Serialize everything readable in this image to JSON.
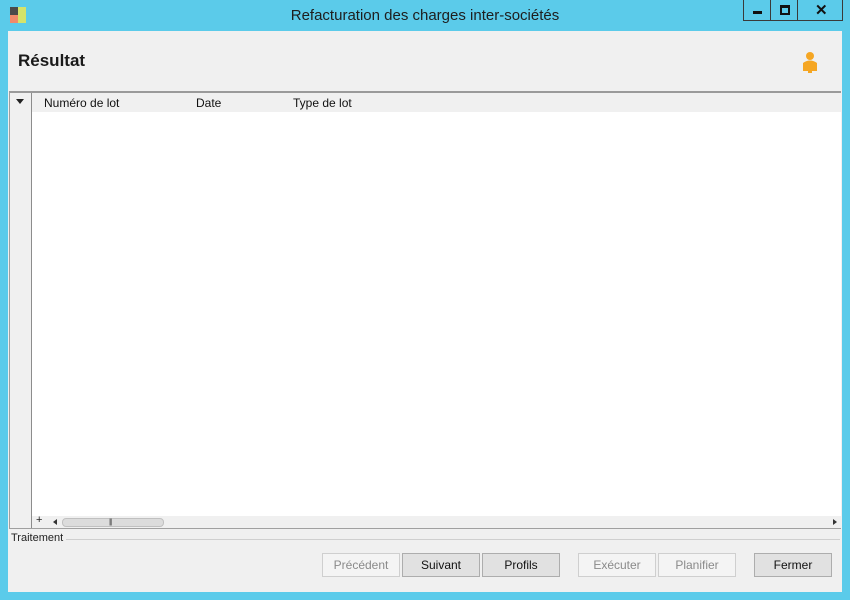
{
  "window": {
    "title": "Refacturation des charges inter-sociétés",
    "controls": {
      "minimize": "minimize-icon",
      "maximize": "maximize-icon",
      "close": "close-icon"
    }
  },
  "header": {
    "title": "Résultat",
    "user_icon": "user-icon"
  },
  "grid": {
    "columns": [
      "Numéro de lot",
      "Date",
      "Type de lot"
    ],
    "rows": []
  },
  "section": {
    "label": "Traitement"
  },
  "buttons": {
    "previous": "Précédent",
    "next": "Suivant",
    "profiles": "Profils",
    "execute": "Exécuter",
    "schedule": "Planifier",
    "close": "Fermer"
  },
  "colors": {
    "frame": "#5bcbea",
    "client": "#f0f0f0",
    "accent_user": "#f5a623"
  }
}
